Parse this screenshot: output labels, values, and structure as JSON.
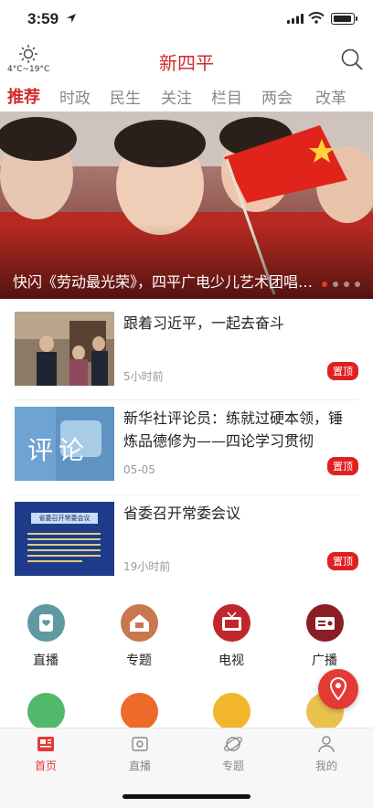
{
  "status_bar": {
    "time": "3:59"
  },
  "header": {
    "weather_temp": "4°C~19°C",
    "app_title": "新四平"
  },
  "tabs": [
    {
      "label": "推荐"
    },
    {
      "label": "时政"
    },
    {
      "label": "民生"
    },
    {
      "label": "关注"
    },
    {
      "label": "栏目"
    },
    {
      "label": "两会"
    },
    {
      "label": "改革"
    }
  ],
  "banner": {
    "caption": "快闪《劳动最光荣》，四平广电少儿艺术团唱响劳动之歌"
  },
  "news": [
    {
      "title": "跟着习近平，一起去奋斗",
      "time": "5小时前",
      "pin": "置顶"
    },
    {
      "title": "新华社评论员：练就过硬本领，锤炼品德修为——四论学习贯彻",
      "time": "05-05",
      "pin": "置顶",
      "thumb_text": "评论"
    },
    {
      "title": "省委召开常委会议",
      "time": "19小时前",
      "pin": "置顶",
      "thumb_text": "省委召开常委会议"
    }
  ],
  "grid": [
    {
      "label": "直播",
      "color": "#5f9aa0"
    },
    {
      "label": "专题",
      "color": "#c9774f"
    },
    {
      "label": "电视",
      "color": "#c0272d"
    },
    {
      "label": "广播",
      "color": "#8a1e24"
    },
    {
      "label": "",
      "color": "#52b86a"
    },
    {
      "label": "",
      "color": "#ee6a2a"
    },
    {
      "label": "",
      "color": "#f2b62c"
    },
    {
      "label": "",
      "color": "#e9c24e"
    }
  ],
  "tabbar": [
    {
      "label": "首页"
    },
    {
      "label": "直播"
    },
    {
      "label": "专题"
    },
    {
      "label": "我的"
    }
  ],
  "colors": {
    "accent": "#d22b2b",
    "pin": "#e02020"
  }
}
